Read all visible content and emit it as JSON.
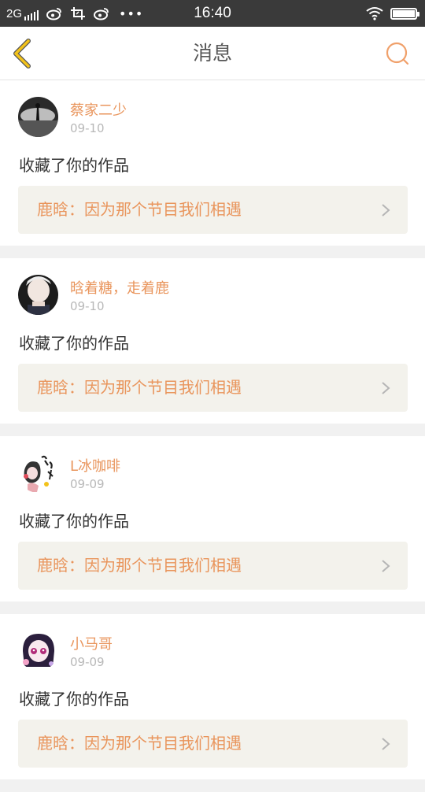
{
  "status_bar": {
    "network": "2G",
    "time": "16:40",
    "battery_level": 1.0,
    "icons": [
      "signal-icon",
      "weibo-icon",
      "screenshot-crop-icon",
      "weibo-icon",
      "more-dots-icon",
      "wifi-icon",
      "battery-icon"
    ]
  },
  "header": {
    "title": "消息",
    "back_icon": "chevron-left-icon",
    "search_icon": "search-icon"
  },
  "colors": {
    "accent": "#e9955c",
    "back_arrow": "#f2c21b",
    "card_link_bg": "#f3f2ec",
    "status_bar_bg": "#3a3a3a"
  },
  "messages": [
    {
      "user": "蔡家二少",
      "date": "09-10",
      "action": "收藏了你的作品",
      "work": "鹿晗：因为那个节目我们相遇"
    },
    {
      "user": "晗着糖，走着鹿",
      "date": "09-10",
      "action": "收藏了你的作品",
      "work": "鹿晗：因为那个节目我们相遇"
    },
    {
      "user": "L冰咖啡",
      "date": "09-09",
      "action": "收藏了你的作品",
      "work": "鹿晗：因为那个节目我们相遇"
    },
    {
      "user": "小马哥",
      "date": "09-09",
      "action": "收藏了你的作品",
      "work": "鹿晗：因为那个节目我们相遇"
    }
  ]
}
